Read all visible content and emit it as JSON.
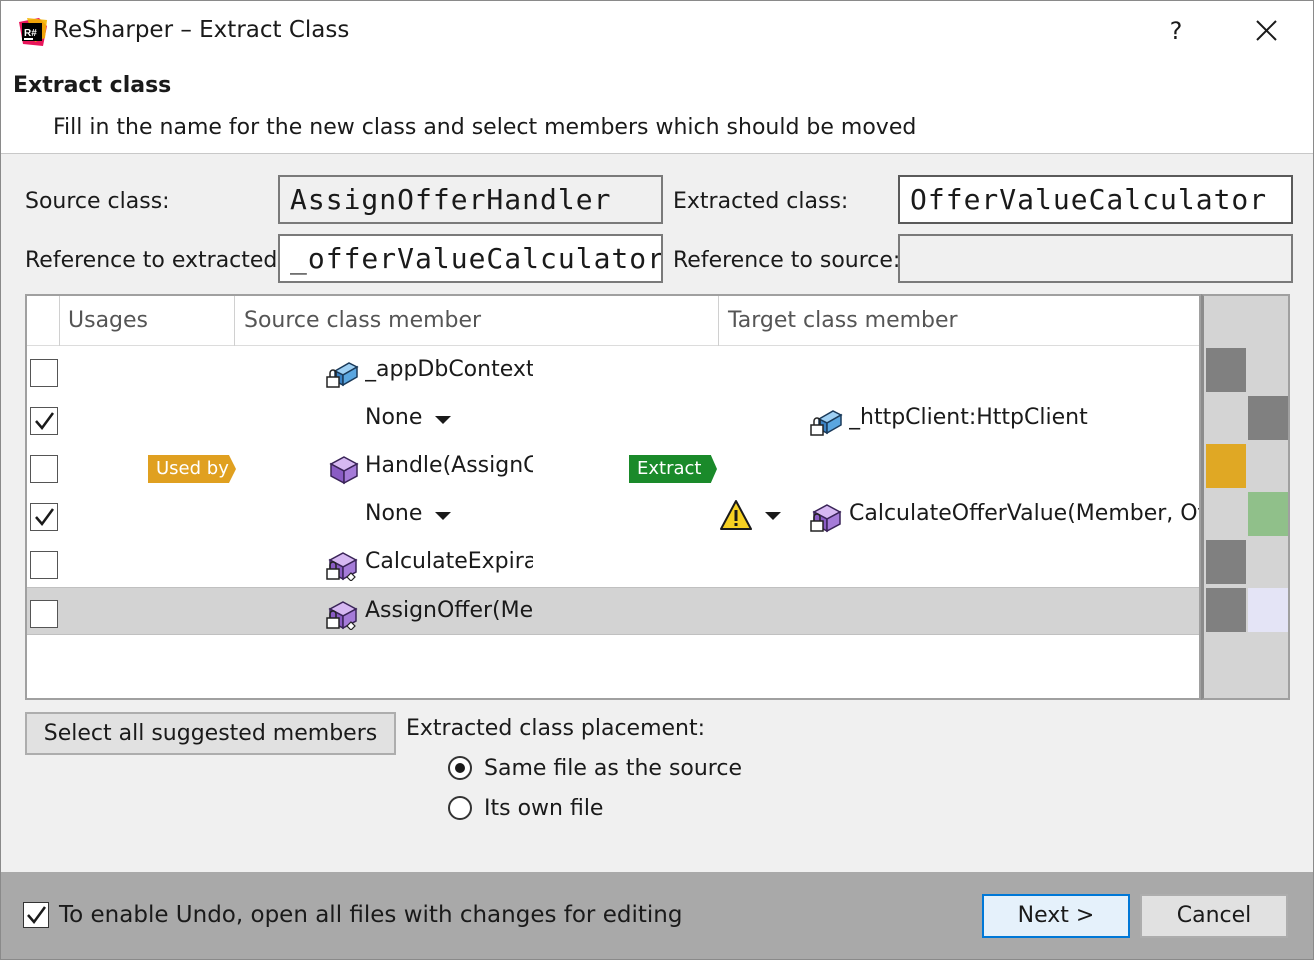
{
  "window": {
    "title": "ReSharper – Extract Class",
    "help_label": "?"
  },
  "header": {
    "title": "Extract class",
    "subtitle": "Fill in the name for the new class and select members which should be moved"
  },
  "form": {
    "source_class_label": "Source class:",
    "source_class_value": "AssignOfferHandler",
    "extracted_class_label": "Extracted class:",
    "extracted_class_value": "OfferValueCalculator",
    "ref_extracted_label": "Reference to extracted:",
    "ref_extracted_value": "_offerValueCalculator",
    "ref_source_label": "Reference to source:",
    "ref_source_value": ""
  },
  "grid": {
    "columns": [
      "Usages",
      "Source class member",
      "Target class member"
    ],
    "rows": [
      {
        "checked": false,
        "usage_tag": "",
        "source_member": "_appDbContext:",
        "source_icon": "locked-field-icon",
        "action_tag": "",
        "has_warning": false,
        "target_member": "",
        "target_icon": ""
      },
      {
        "checked": true,
        "usage_tag": "",
        "source_member": "None",
        "source_icon": "",
        "action_tag": "",
        "has_warning": false,
        "target_member": "_httpClient:HttpClient",
        "target_icon": "locked-field-icon"
      },
      {
        "checked": false,
        "usage_tag": "Used by",
        "source_member": "Handle(AssignC",
        "source_icon": "method-icon",
        "action_tag": "Extract",
        "has_warning": false,
        "target_member": "",
        "target_icon": ""
      },
      {
        "checked": true,
        "usage_tag": "",
        "source_member": "None",
        "source_icon": "",
        "action_tag": "",
        "has_warning": true,
        "target_member": "CalculateOfferValue(Member, Off",
        "target_icon": "locked-method-icon"
      },
      {
        "checked": false,
        "usage_tag": "",
        "source_member": "CalculateExpirat",
        "source_icon": "private-method-icon",
        "action_tag": "",
        "has_warning": false,
        "target_member": "",
        "target_icon": ""
      },
      {
        "checked": false,
        "usage_tag": "",
        "source_member": "AssignOffer(Me",
        "source_icon": "private-method-icon",
        "action_tag": "",
        "has_warning": false,
        "target_member": "",
        "target_icon": "",
        "selected": true
      }
    ]
  },
  "minimap_colors": {
    "gray": "#808080",
    "orange": "#e0a824",
    "green": "#90c08a",
    "lavender": "#e4e4f6"
  },
  "actions": {
    "select_all_label": "Select all suggested members",
    "placement_label": "Extracted class placement:",
    "placement_options": [
      "Same file as the source",
      "Its own file"
    ],
    "placement_selected": "Same file as the source"
  },
  "footer": {
    "undo_checked": true,
    "undo_label": "To enable Undo, open all files with changes for editing",
    "next_label": "Next >",
    "cancel_label": "Cancel"
  }
}
